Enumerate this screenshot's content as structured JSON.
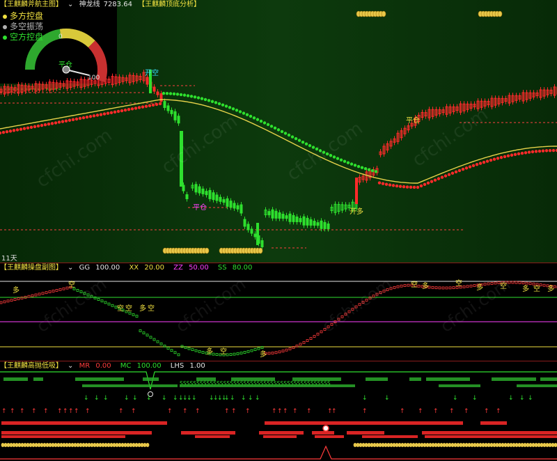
{
  "main_panel": {
    "title": "【王麒麟斧航主图】",
    "dropdown_icon": "chevron-down-icon",
    "indicator_name": "神龙线",
    "indicator_value": "7283.64",
    "subtitle": "【王麒麟顶底分析】",
    "legend": [
      {
        "label": "多方控盘",
        "color": "#f0e040"
      },
      {
        "label": "多空振荡",
        "color": "#b0b0b0"
      },
      {
        "label": "空方控盘",
        "color": "#2fe02f"
      }
    ],
    "gauge": {
      "min": "0",
      "max": "100",
      "level": 0.15
    },
    "signals": {
      "kaikong": "开空",
      "pingcang1": "平仓",
      "pingcang2": "平仓",
      "kaiduo": "开多",
      "pingcang3": "平仓"
    },
    "timeframe": "11天",
    "colors": {
      "bull": "#ff2a2a",
      "bear": "#2ee02e",
      "line": "#e6d24a"
    }
  },
  "sub_panel": {
    "title": "【王麒麟操盘副图】",
    "dropdown_icon": "chevron-down-icon",
    "params": [
      {
        "name": "GG",
        "value": "100.00",
        "color": "#e6e6e6"
      },
      {
        "name": "XX",
        "value": "20.00",
        "color": "#f0e040"
      },
      {
        "name": "ZZ",
        "value": "50.00",
        "color": "#ff40ff"
      },
      {
        "name": "SS",
        "value": "80.00",
        "color": "#2fe02f"
      }
    ],
    "marks": [
      "多",
      "空"
    ]
  },
  "low_panel": {
    "title": "【王麒麟高抛低吸】",
    "dropdown_icon": "chevron-down-icon",
    "params": [
      {
        "name": "MR",
        "value": "0.00",
        "color": "#ff3b3b"
      },
      {
        "name": "MC",
        "value": "100.00",
        "color": "#2fe02f"
      },
      {
        "name": "LHS",
        "value": "1.00",
        "color": "#e6e6e6"
      }
    ],
    "band_text": "SSSSSSSSSSSSSSSSSSSSSSSSSSSSSSSSSSSSSSSSSSSSS"
  }
}
